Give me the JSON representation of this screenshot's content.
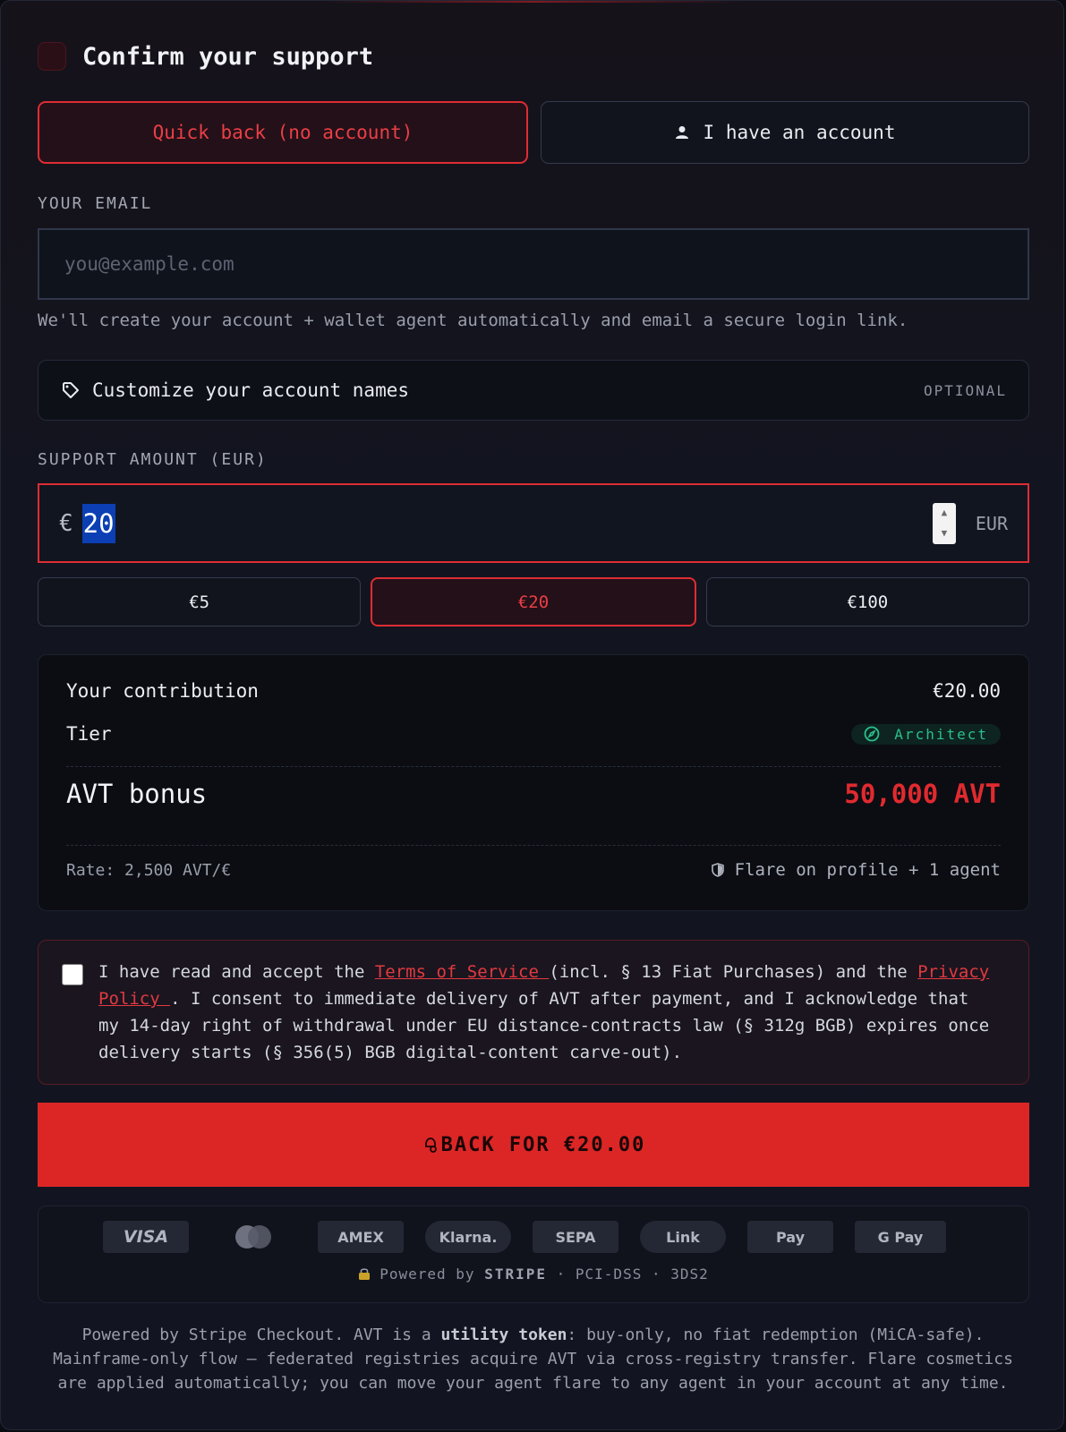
{
  "header": {
    "title": "Confirm your support"
  },
  "modes": {
    "quick_label": "Quick back (no account)",
    "account_label": "I have an account"
  },
  "email": {
    "label": "YOUR EMAIL",
    "placeholder": "you@example.com",
    "value": "",
    "helper": "We'll create your account + wallet agent automatically and email a secure login link."
  },
  "customize": {
    "label": "Customize your account names",
    "optional": "OPTIONAL"
  },
  "amount": {
    "label": "SUPPORT AMOUNT (EUR)",
    "currency_symbol": "€",
    "value": "20",
    "unit": "EUR"
  },
  "presets": [
    "€5",
    "€20",
    "€100"
  ],
  "summary": {
    "contribution_label": "Your contribution",
    "contribution_value": "€20.00",
    "tier_label": "Tier",
    "tier_value": "Architect",
    "bonus_label": "AVT bonus",
    "bonus_value": "50,000 AVT",
    "rate": "Rate: 2,500 AVT/€",
    "flare": "Flare on profile + 1 agent"
  },
  "consent": {
    "p1": "I have read and accept the ",
    "tos_link": "Terms of Service ",
    "p2": "(incl. § 13 Fiat Purchases) and the ",
    "privacy_link": "Privacy Policy ",
    "p3": ". I consent to immediate delivery of AVT after payment, and I acknowledge that my 14-day right of withdrawal under EU distance-contracts law (§ 312g BGB) expires once delivery starts (§ 356(5) BGB digital-content carve-out)."
  },
  "cta": {
    "label": "BACK FOR €20.00"
  },
  "payment_methods": {
    "visa": "VISA",
    "amex": "AMEX",
    "klarna": "Klarna.",
    "sepa": "SEPA",
    "link": "Link",
    "apple": "Pay",
    "gpay": "G Pay"
  },
  "powered": {
    "prefix": "Powered by ",
    "brand": "STRIPE",
    "suffix": " · PCI-DSS · 3DS2"
  },
  "footnote": {
    "p1": "Powered by Stripe Checkout. AVT is a ",
    "bold": "utility token",
    "p2": ": buy-only, no fiat redemption (MiCA-safe).",
    "line2": "Mainframe-only flow — federated registries acquire AVT via cross-registry transfer. Flare cosmetics",
    "line3": "are applied automatically; you can move your agent flare to any agent in your account at any time."
  },
  "colors": {
    "accent": "#dc2626",
    "tier": "#2bbf8a",
    "bonus": "#e02a2f"
  }
}
